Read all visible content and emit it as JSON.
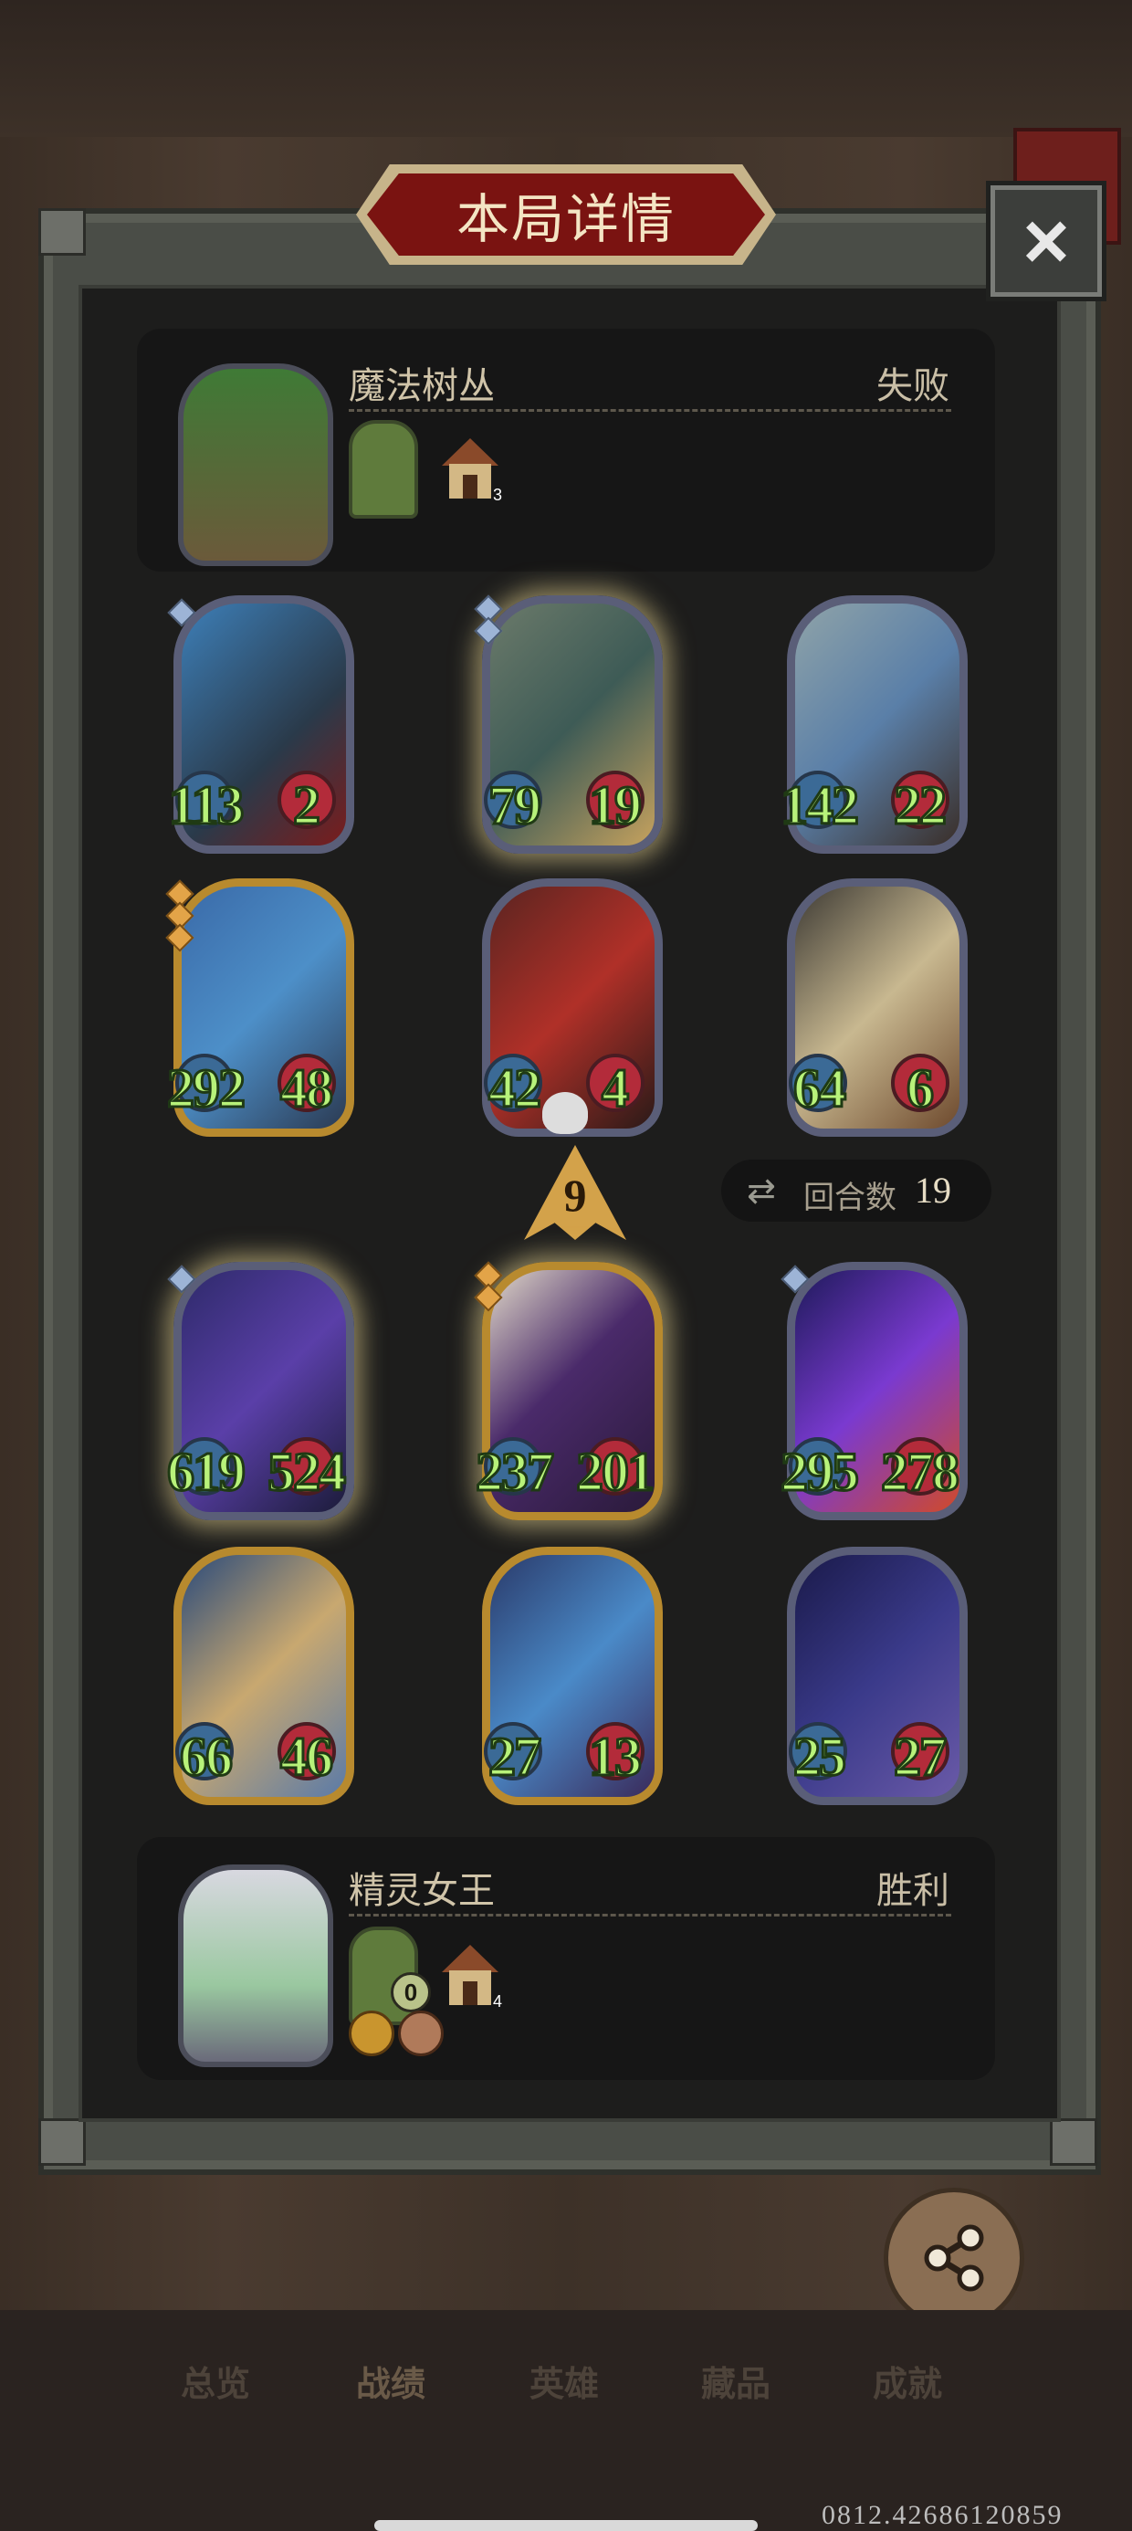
{
  "title": "本局详情",
  "close_label": "×",
  "opponent": {
    "name": "魔法树丛",
    "result": "失败",
    "tavern_level": "3"
  },
  "player": {
    "name": "精灵女王",
    "result": "胜利",
    "tavern_level": "4",
    "counter": "0"
  },
  "opponent_board": [
    {
      "attack": "113",
      "health": "2"
    },
    {
      "attack": "79",
      "health": "19"
    },
    {
      "attack": "142",
      "health": "22"
    },
    {
      "attack": "292",
      "health": "48"
    },
    {
      "attack": "42",
      "health": "4"
    },
    {
      "attack": "64",
      "health": "6"
    }
  ],
  "player_board": [
    {
      "attack": "619",
      "health": "524"
    },
    {
      "attack": "237",
      "health": "201"
    },
    {
      "attack": "295",
      "health": "278"
    },
    {
      "attack": "66",
      "health": "46"
    },
    {
      "attack": "27",
      "health": "13"
    },
    {
      "attack": "25",
      "health": "27"
    }
  ],
  "damage_taken": "9",
  "rounds": {
    "label": "回合数",
    "value": "19"
  },
  "share_label": "分享",
  "nav": {
    "overview": "总览",
    "record": "战绩",
    "heroes": "英雄",
    "collection": "藏品",
    "achievements": "成就"
  },
  "watermark": "0812.42686120859",
  "colors": {
    "accent_red": "#7a1311",
    "stat_green": "#b8f27a"
  }
}
